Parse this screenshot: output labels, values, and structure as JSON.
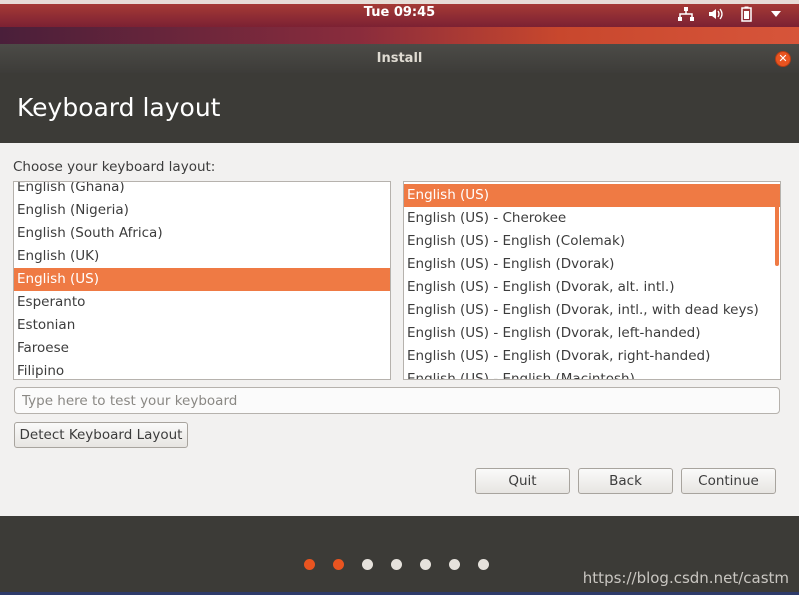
{
  "panel": {
    "clock": "Tue 09:45",
    "icons": [
      "network-icon",
      "volume-icon",
      "battery-icon",
      "chevron-down-icon"
    ]
  },
  "window": {
    "title": "Install",
    "close_icon": "close-icon"
  },
  "header": {
    "title": "Keyboard layout"
  },
  "prompt": "Choose your keyboard layout:",
  "layouts": {
    "items": [
      {
        "label": "English (Ghana)"
      },
      {
        "label": "English (Nigeria)"
      },
      {
        "label": "English (South Africa)"
      },
      {
        "label": "English (UK)"
      },
      {
        "label": "English (US)"
      },
      {
        "label": "Esperanto"
      },
      {
        "label": "Estonian"
      },
      {
        "label": "Faroese"
      },
      {
        "label": "Filipino"
      }
    ],
    "selected": "English (US)"
  },
  "variants": {
    "items": [
      {
        "label": "English (US)"
      },
      {
        "label": "English (US) - Cherokee"
      },
      {
        "label": "English (US) - English (Colemak)"
      },
      {
        "label": "English (US) - English (Dvorak)"
      },
      {
        "label": "English (US) - English (Dvorak, alt. intl.)"
      },
      {
        "label": "English (US) - English (Dvorak, intl., with dead keys)"
      },
      {
        "label": "English (US) - English (Dvorak, left-handed)"
      },
      {
        "label": "English (US) - English (Dvorak, right-handed)"
      },
      {
        "label": "English (US) - English (Macintosh)"
      }
    ],
    "selected": "English (US)"
  },
  "test_field": {
    "placeholder": "Type here to test your keyboard",
    "value": ""
  },
  "buttons": {
    "detect": "Detect Keyboard Layout",
    "quit": "Quit",
    "back": "Back",
    "continue": "Continue"
  },
  "progress": {
    "total_steps": 7,
    "completed_steps": 2
  },
  "watermark": "https://blog.csdn.net/castm",
  "colors": {
    "accent": "#ef7a44",
    "close": "#e95420",
    "header_bg": "#3c3b37",
    "window_bg": "#f2f1f0"
  }
}
